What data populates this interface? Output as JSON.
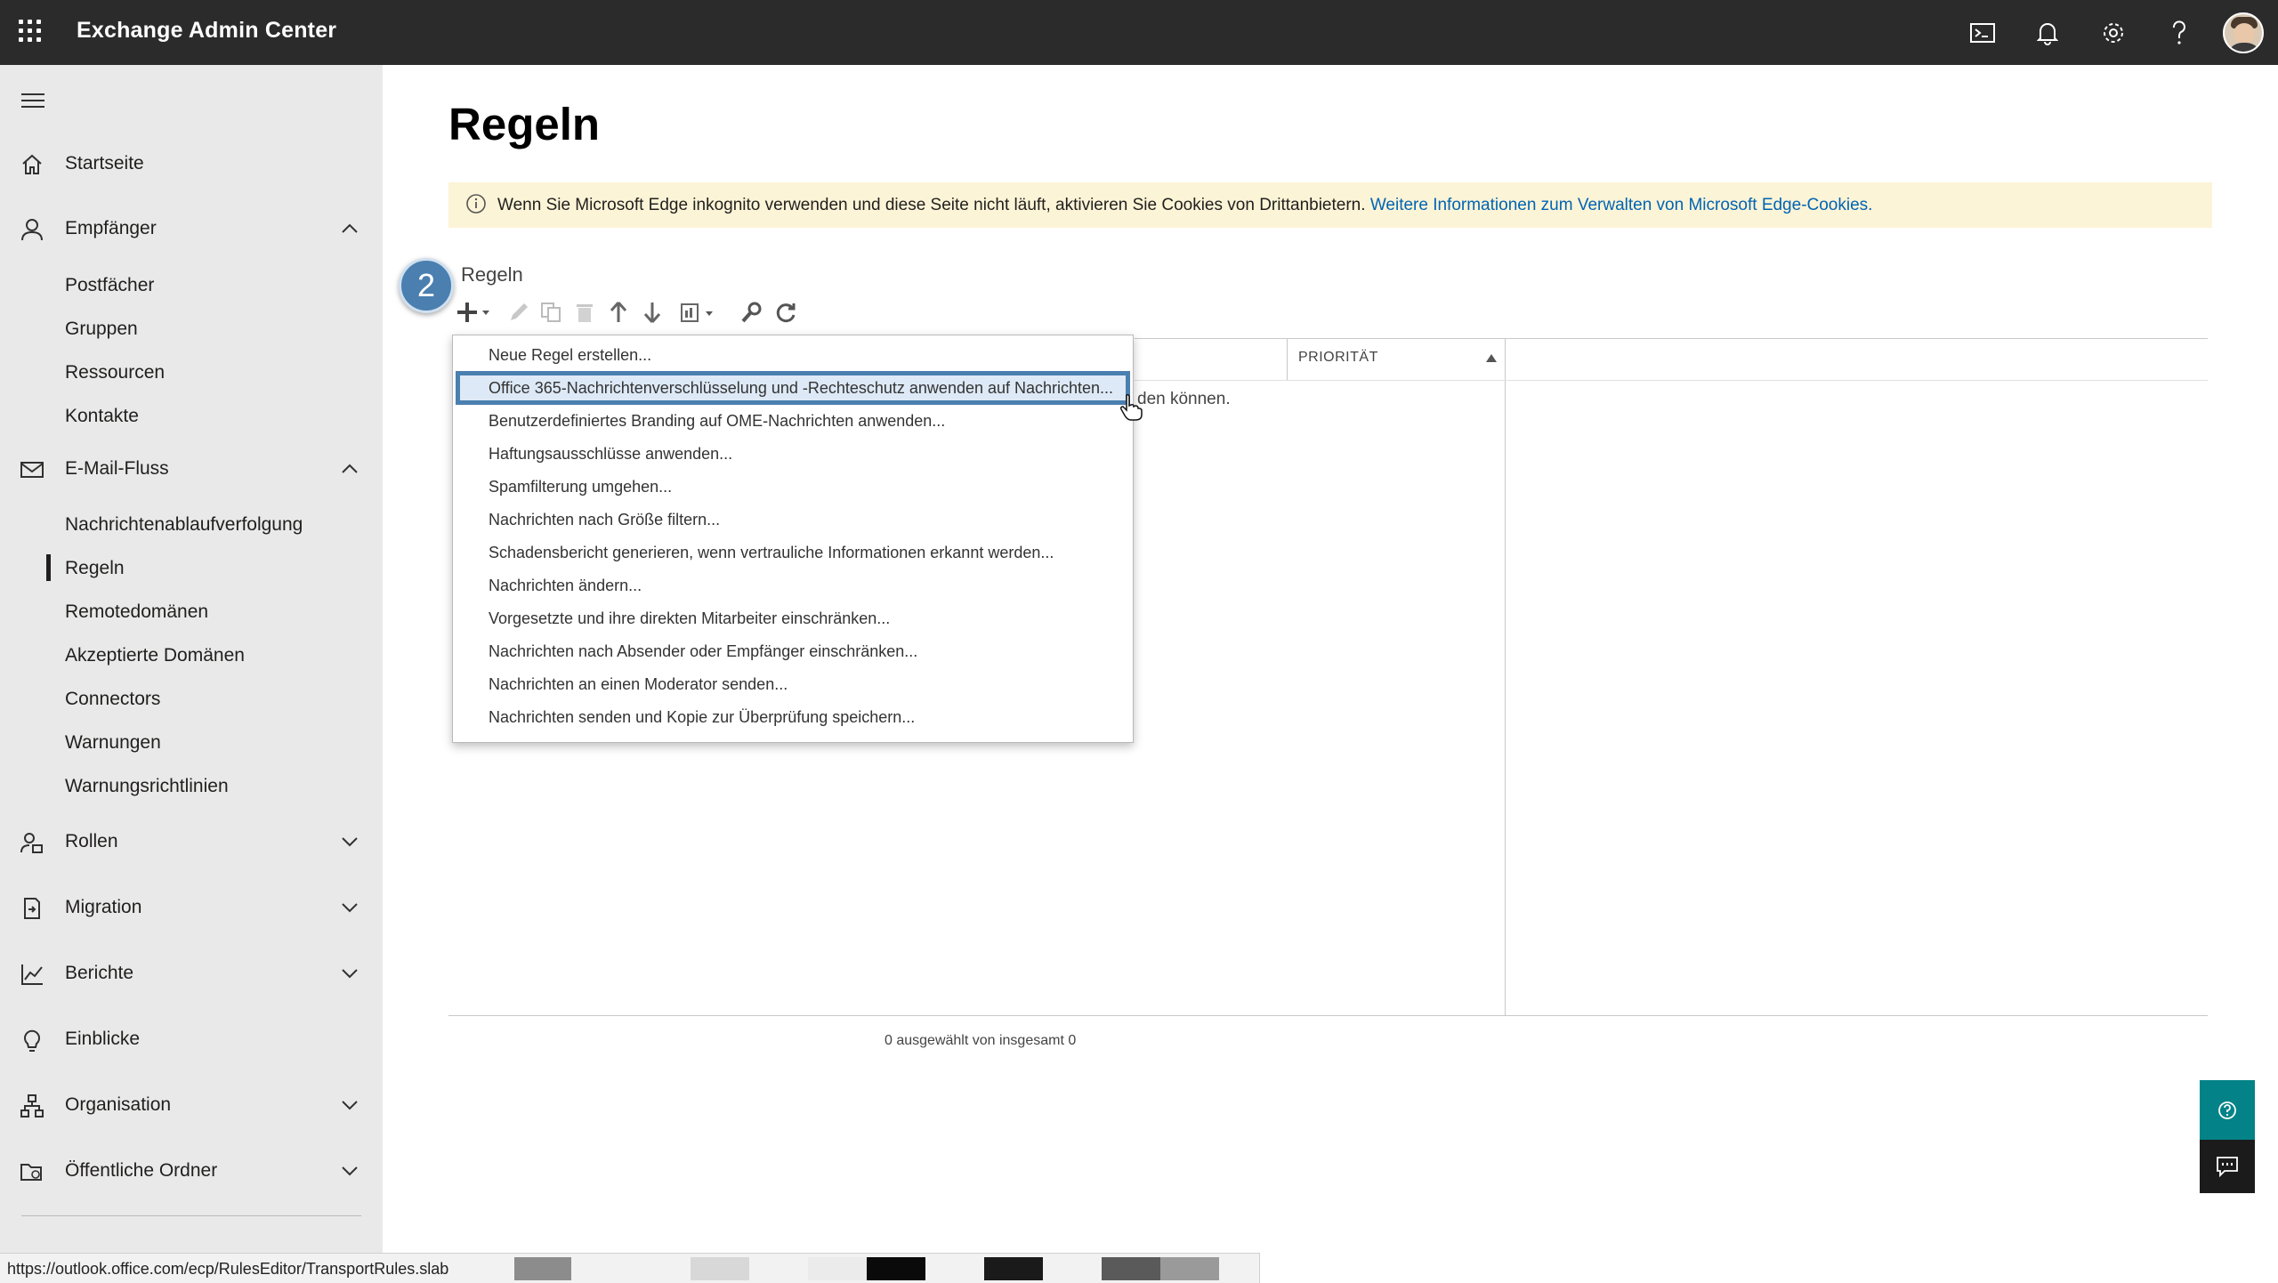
{
  "app": {
    "title": "Exchange Admin Center"
  },
  "topbar": {
    "icons": [
      "cloud-shell-icon",
      "bell-icon",
      "gear-icon",
      "help-icon"
    ]
  },
  "sidebar": {
    "items": [
      {
        "label": "Startseite",
        "icon": "home-icon"
      },
      {
        "label": "Empfänger",
        "icon": "person-icon",
        "expanded": true,
        "children": [
          "Postfächer",
          "Gruppen",
          "Ressourcen",
          "Kontakte"
        ]
      },
      {
        "label": "E-Mail-Fluss",
        "icon": "mail-icon",
        "expanded": true,
        "children": [
          "Nachrichtenablaufverfolgung",
          "Regeln",
          "Remotedomänen",
          "Akzeptierte Domänen",
          "Connectors",
          "Warnungen",
          "Warnungsrichtlinien"
        ]
      },
      {
        "label": "Rollen",
        "icon": "roles-icon",
        "expanded": false
      },
      {
        "label": "Migration",
        "icon": "migration-icon",
        "expanded": false
      },
      {
        "label": "Berichte",
        "icon": "chart-icon",
        "expanded": false
      },
      {
        "label": "Einblicke",
        "icon": "lightbulb-icon"
      },
      {
        "label": "Organisation",
        "icon": "org-icon",
        "expanded": false
      },
      {
        "label": "Öffentliche Ordner",
        "icon": "public-folder-icon",
        "expanded": false
      }
    ],
    "active": "Regeln"
  },
  "main": {
    "title": "Regeln",
    "banner": {
      "text": "Wenn Sie Microsoft Edge inkognito verwenden und diese Seite nicht läuft, aktivieren Sie Cookies von Drittanbietern.",
      "link": "Weitere Informationen zum Verwalten von Microsoft Edge-Cookies."
    },
    "step_badge": "2",
    "section_label": "Regeln",
    "table": {
      "column_priority": "PRIORITÄT",
      "empty_text_fragment": "den können.",
      "selection_count": "0 ausgewählt von insgesamt 0"
    }
  },
  "dropdown": {
    "items": [
      "Neue Regel erstellen...",
      "Office 365-Nachrichtenverschlüsselung und -Rechteschutz anwenden auf Nachrichten...",
      "Benutzerdefiniertes Branding auf OME-Nachrichten anwenden...",
      "Haftungsausschlüsse anwenden...",
      "Spamfilterung umgehen...",
      "Nachrichten nach Größe filtern...",
      "Schadensbericht generieren, wenn vertrauliche Informationen erkannt werden...",
      "Nachrichten ändern...",
      "Vorgesetzte und ihre direkten Mitarbeiter einschränken...",
      "Nachrichten nach Absender oder Empfänger einschränken...",
      "Nachrichten an einen Moderator senden...",
      "Nachrichten senden und Kopie zur Überprüfung speichern..."
    ],
    "highlighted": "Office 365-Nachrichtenverschlüsselung und -Rechteschutz anwenden auf Nachrichten..."
  },
  "statusbar": {
    "url": "https://outlook.office.com/ecp/RulesEditor/TransportRules.slab"
  },
  "colors": {
    "topbar": "#2b2b2b",
    "sidebar": "#e9e9e9",
    "banner": "#fcf4d6",
    "link": "#0064b4",
    "accent": "#4a7fb0",
    "help_teal": "#038387"
  }
}
